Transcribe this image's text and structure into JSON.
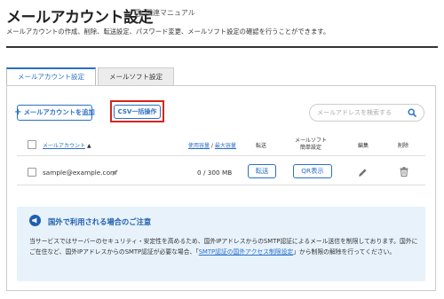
{
  "page": {
    "title": "メールアカウント設定",
    "manual_label": "関連マニュアル",
    "manual_icon": "help-circle-icon",
    "subtitle": "メールアカウントの作成、削除、転送設定、パスワード変更、メールソフト設定の確認を行うことができます。"
  },
  "tabs": [
    {
      "label": "メールアカウント設定",
      "active": true
    },
    {
      "label": "メールソフト設定",
      "active": false
    }
  ],
  "toolbar": {
    "add_label": "メールアカウントを追加",
    "add_icon": "plus-icon",
    "csv_label": "CSV一括操作",
    "search_placeholder": "メールアドレスを検索する",
    "search_value": "",
    "search_icon": "search-icon"
  },
  "table": {
    "headers": {
      "account": "メールアカウント",
      "account_sort": "▲",
      "usage_used": "使用容量",
      "usage_sep": " / ",
      "usage_max": "最大容量",
      "forward": "転送",
      "mailsoft_line1": "メールソフト",
      "mailsoft_line2": "簡単設定",
      "edit": "編集",
      "delete": "削除"
    },
    "rows": [
      {
        "account": "sample@example.com",
        "usage": "0 / 300 MB",
        "forward_label": "転送",
        "qr_label": "QR表示"
      }
    ]
  },
  "notice": {
    "icon": "megaphone-icon",
    "title": "国外で利用される場合のご注意",
    "body_before": "当サービスではサーバーのセキュリティ・安定性を高めるため、国外IPアドレスからのSMTP認証によるメール送信を制限しております。国外にご在住など、国外IPアドレスからのSMTP認証が必要な場合、「",
    "link_text": "SMTP認証の国外アクセス制限設定",
    "body_after": "」から制限の解除を行ってください。"
  },
  "colors": {
    "accent": "#2a6fc9",
    "highlight": "#d6251b",
    "notice_bg": "#e8f2fb"
  }
}
